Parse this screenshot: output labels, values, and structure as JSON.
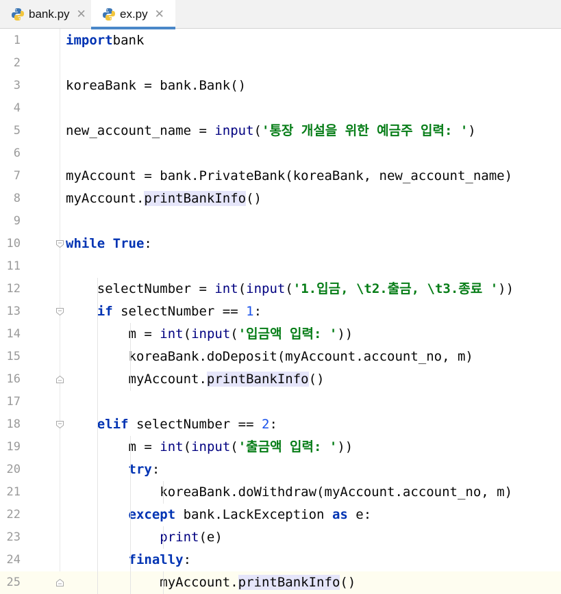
{
  "tabs": [
    {
      "label": "bank.py",
      "active": false
    },
    {
      "label": "ex.py",
      "active": true
    }
  ],
  "colors": {
    "keyword": "#0033b3",
    "string": "#067d17",
    "number": "#1750eb",
    "builtin": "#000080",
    "highlight": "#e5e5fa",
    "caret_line": "#fefdf0"
  },
  "lines": [
    {
      "n": "1",
      "indent": "",
      "t": [
        [
          "kw",
          "import"
        ],
        [
          "",
          "bank"
        ]
      ]
    },
    {
      "n": "2",
      "indent": "",
      "t": []
    },
    {
      "n": "3",
      "indent": "",
      "t": [
        [
          "",
          "koreaBank = bank.Bank()"
        ]
      ]
    },
    {
      "n": "4",
      "indent": "",
      "t": []
    },
    {
      "n": "5",
      "indent": "",
      "t": [
        [
          "",
          "new_account_name = "
        ],
        [
          "bi",
          "input"
        ],
        [
          "",
          "("
        ],
        [
          "str",
          "'통장 개설을 위한 예금주 입력: '"
        ],
        [
          "",
          ")"
        ]
      ]
    },
    {
      "n": "6",
      "indent": "",
      "t": []
    },
    {
      "n": "7",
      "indent": "",
      "t": [
        [
          "",
          "myAccount = bank.PrivateBank(koreaBank, new_account_name)"
        ]
      ]
    },
    {
      "n": "8",
      "indent": "",
      "t": [
        [
          "",
          "myAccount."
        ],
        [
          "hl",
          "printBankInfo"
        ],
        [
          "",
          "()"
        ]
      ]
    },
    {
      "n": "9",
      "indent": "",
      "t": []
    },
    {
      "n": "10",
      "indent": "",
      "t": [
        [
          "kw",
          "while"
        ],
        [
          "",
          " "
        ],
        [
          "kw",
          "True"
        ],
        [
          "",
          ":"
        ]
      ]
    },
    {
      "n": "11",
      "indent": "",
      "t": []
    },
    {
      "n": "12",
      "indent": "    ",
      "t": [
        [
          "",
          "selectNumber = "
        ],
        [
          "bi",
          "int"
        ],
        [
          "",
          "("
        ],
        [
          "bi",
          "input"
        ],
        [
          "",
          "("
        ],
        [
          "str",
          "'1.입금, \\t2.출금, \\t3.종료 '"
        ],
        [
          "",
          "))"
        ]
      ]
    },
    {
      "n": "13",
      "indent": "    ",
      "t": [
        [
          "kw",
          "if"
        ],
        [
          "",
          " selectNumber == "
        ],
        [
          "num",
          "1"
        ],
        [
          "",
          ":"
        ]
      ]
    },
    {
      "n": "14",
      "indent": "        ",
      "t": [
        [
          "",
          "m = "
        ],
        [
          "bi",
          "int"
        ],
        [
          "",
          "("
        ],
        [
          "bi",
          "input"
        ],
        [
          "",
          "("
        ],
        [
          "str",
          "'입금액 입력: '"
        ],
        [
          "",
          "))"
        ]
      ]
    },
    {
      "n": "15",
      "indent": "        ",
      "t": [
        [
          "",
          "koreaBank.doDeposit(myAccount.account_no, m)"
        ]
      ]
    },
    {
      "n": "16",
      "indent": "        ",
      "t": [
        [
          "",
          "myAccount."
        ],
        [
          "hl",
          "printBankInfo"
        ],
        [
          "",
          "()"
        ]
      ]
    },
    {
      "n": "17",
      "indent": "",
      "t": []
    },
    {
      "n": "18",
      "indent": "    ",
      "t": [
        [
          "kw",
          "elif"
        ],
        [
          "",
          " selectNumber == "
        ],
        [
          "num",
          "2"
        ],
        [
          "",
          ":"
        ]
      ]
    },
    {
      "n": "19",
      "indent": "        ",
      "t": [
        [
          "",
          "m = "
        ],
        [
          "bi",
          "int"
        ],
        [
          "",
          "("
        ],
        [
          "bi",
          "input"
        ],
        [
          "",
          "("
        ],
        [
          "str",
          "'출금액 입력: '"
        ],
        [
          "",
          "))"
        ]
      ]
    },
    {
      "n": "20",
      "indent": "        ",
      "t": [
        [
          "kw",
          "try"
        ],
        [
          "",
          ":"
        ]
      ]
    },
    {
      "n": "21",
      "indent": "            ",
      "t": [
        [
          "",
          "koreaBank.doWithdraw(myAccount.account_no, m)"
        ]
      ]
    },
    {
      "n": "22",
      "indent": "        ",
      "t": [
        [
          "kw",
          "except"
        ],
        [
          "",
          " bank.LackException "
        ],
        [
          "kw",
          "as"
        ],
        [
          "",
          " e:"
        ]
      ]
    },
    {
      "n": "23",
      "indent": "            ",
      "t": [
        [
          "bi",
          "print"
        ],
        [
          "",
          "(e)"
        ]
      ]
    },
    {
      "n": "24",
      "indent": "        ",
      "t": [
        [
          "kw",
          "finally"
        ],
        [
          "",
          ":"
        ]
      ]
    },
    {
      "n": "25",
      "indent": "            ",
      "t": [
        [
          "",
          "myAccount."
        ],
        [
          "hl",
          "printBankInfo"
        ],
        [
          "",
          "()"
        ]
      ],
      "caret": true
    }
  ]
}
